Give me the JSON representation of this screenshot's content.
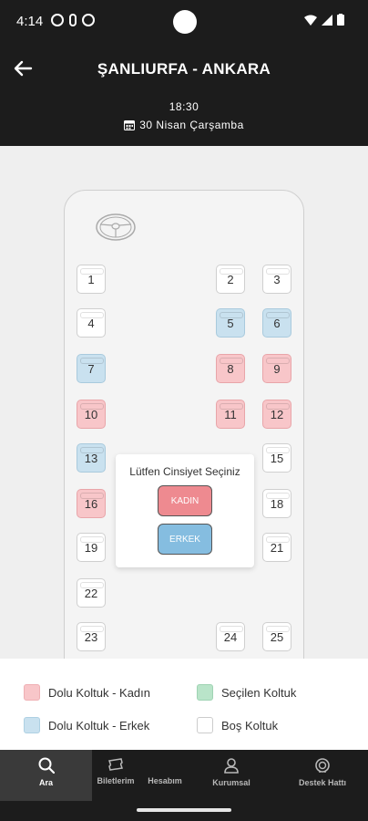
{
  "status": {
    "time": "4:14"
  },
  "header": {
    "route": "ŞANLIURFA - ANKARA",
    "departure_time": "18:30",
    "date": "30 Nisan Çarşamba"
  },
  "seats": [
    {
      "n": "1",
      "s": "empty"
    },
    {
      "n": "2",
      "s": "empty"
    },
    {
      "n": "3",
      "s": "empty"
    },
    {
      "n": "4",
      "s": "empty"
    },
    {
      "n": "5",
      "s": "male"
    },
    {
      "n": "6",
      "s": "male"
    },
    {
      "n": "7",
      "s": "male"
    },
    {
      "n": "8",
      "s": "female"
    },
    {
      "n": "9",
      "s": "female"
    },
    {
      "n": "10",
      "s": "female"
    },
    {
      "n": "11",
      "s": "female"
    },
    {
      "n": "12",
      "s": "female"
    },
    {
      "n": "13",
      "s": "male"
    },
    {
      "n": "15",
      "s": "empty"
    },
    {
      "n": "16",
      "s": "female"
    },
    {
      "n": "18",
      "s": "empty"
    },
    {
      "n": "19",
      "s": "empty"
    },
    {
      "n": "21",
      "s": "empty"
    },
    {
      "n": "22",
      "s": "empty"
    },
    {
      "n": "23",
      "s": "empty"
    },
    {
      "n": "24",
      "s": "empty"
    },
    {
      "n": "25",
      "s": "empty"
    }
  ],
  "gender_dialog": {
    "title": "Lütfen Cinsiyet Seçiniz",
    "female_label": "KADIN",
    "male_label": "ERKEK"
  },
  "legend": {
    "female_occupied": "Dolu Koltuk - Kadın",
    "selected": "Seçilen Koltuk",
    "male_occupied": "Dolu Koltuk - Erkek",
    "empty": "Boş Koltuk"
  },
  "colors": {
    "female": "#f8c6c9",
    "male": "#c9e1ef",
    "selected": "#b9e4c9",
    "empty": "#ffffff"
  },
  "tabs": [
    {
      "label": "Ara",
      "icon": "search-icon",
      "active": true
    },
    {
      "label": "Biletlerim",
      "icon": "ticket-icon"
    },
    {
      "label": "Hesabım",
      "icon": "account-icon"
    },
    {
      "label": "Kurumsal",
      "icon": "user-icon"
    },
    {
      "label": "Destek Hattı",
      "icon": "support-icon"
    }
  ]
}
